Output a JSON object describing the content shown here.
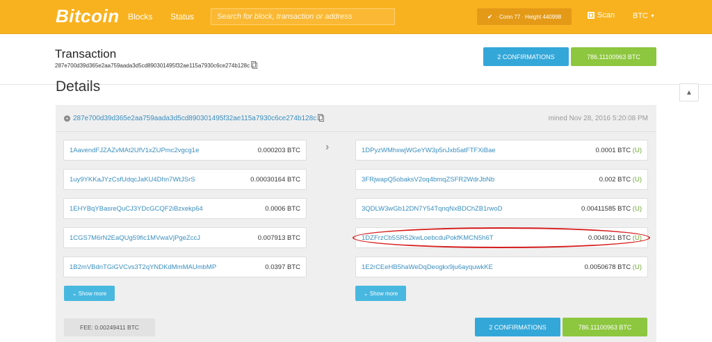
{
  "nav": {
    "brand": "Bitcoin",
    "blocks": "Blocks",
    "status": "Status",
    "search_placeholder": "Search for block, transaction or address",
    "conn_label": "Conn",
    "conn_value": "77",
    "height_label": "Height",
    "height_value": "440998",
    "scan": "Scan",
    "currency": "BTC"
  },
  "tx": {
    "title": "Transaction",
    "hash": "287e700d39d365e2aa759aada3d5cd890301495f32ae115a7930c6ce274b128c",
    "confirmations": "2 CONFIRMATIONS",
    "amount": "786.11100963 BTC"
  },
  "details": {
    "title": "Details",
    "hash": "287e700d39d365e2aa759aada3d5cd890301495f32ae115a7930c6ce274b128c",
    "mined": "mined Nov 28, 2016 5:20:08 PM",
    "inputs": [
      {
        "address": "1AavendFJZAZvMAt2UfV1xZUPmc2vgcg1e",
        "value": "0.000203 BTC"
      },
      {
        "address": "1uy9YKKaJYzCsfUdqcJaKU4Dhn7WtJSrS",
        "value": "0.00030164 BTC"
      },
      {
        "address": "1EHYBqYBasreQuCJ3YDcGCQF2iBzxekp64",
        "value": "0.0006 BTC"
      },
      {
        "address": "1CGS7M6rN2EaQUg59fic1MVwaVjPgeZccJ",
        "value": "0.007913 BTC"
      },
      {
        "address": "1B2mVBdnTGiGVCvs3T2qYNDKdMmMAUmbMP",
        "value": "0.0397 BTC"
      }
    ],
    "outputs": [
      {
        "address": "1DPyzWMhxwjWGeYW3p5nJxb5atFTFXiBae",
        "value": "0.0001 BTC",
        "flag": "(U)"
      },
      {
        "address": "3FRjwapQ5obaksV2oq4bmqZSFR2WdrJbNb",
        "value": "0.002 BTC",
        "flag": "(U)"
      },
      {
        "address": "3QDLW3wGb12DN7Y54TqnqNxBDChZB1rwoD",
        "value": "0.00411585 BTC",
        "flag": "(U)"
      },
      {
        "address": "1DZFrzCb5SR52kwLoebcduPokfKMCN5h6T",
        "value": "0.004921 BTC",
        "flag": "(U)"
      },
      {
        "address": "1E2rCEeHB5haWeDqDeogkx9ju6ayquwkKE",
        "value": "0.0050678 BTC",
        "flag": "(U)"
      }
    ],
    "show_more": "Show more",
    "fee": "FEE: 0.00249411 BTC",
    "confirmations": "2 CONFIRMATIONS",
    "amount": "786.11100963 BTC"
  },
  "colors": {
    "nav_bg": "#f9b21f",
    "confirm_blue": "#34a7d9",
    "amount_green": "#8dc63f",
    "highlight_red": "#d61b1b"
  }
}
